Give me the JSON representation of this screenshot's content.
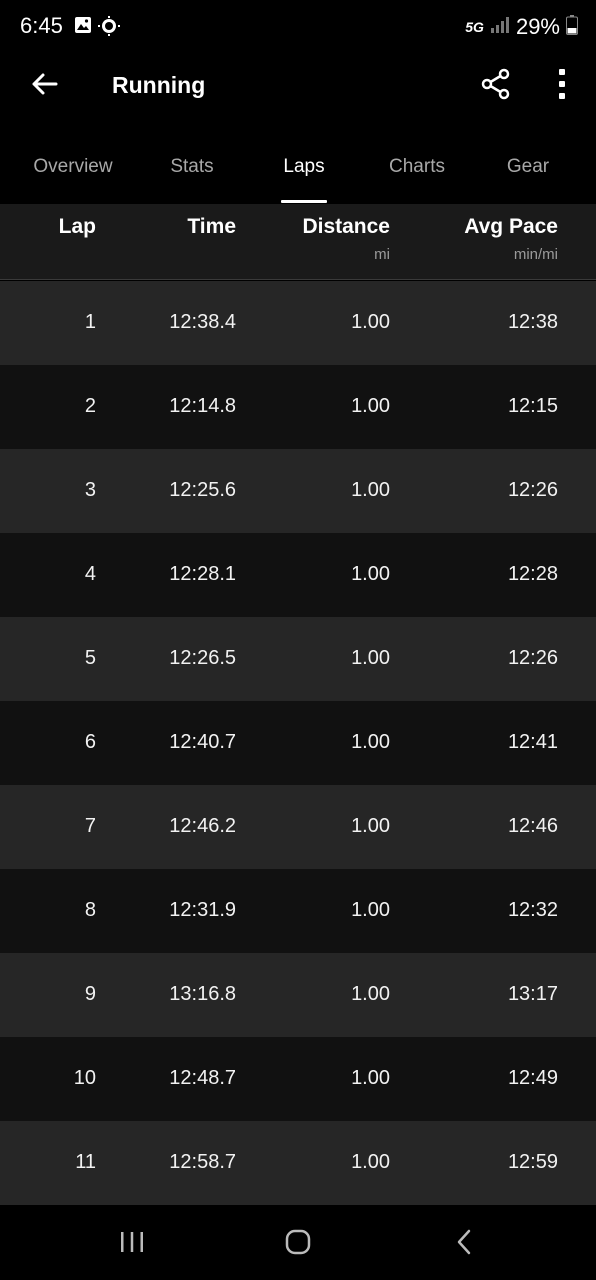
{
  "status_bar": {
    "time": "6:45",
    "network": "5G",
    "battery": "29%"
  },
  "app_bar": {
    "title": "Running"
  },
  "tabs": [
    {
      "label": "Overview",
      "active": false
    },
    {
      "label": "Stats",
      "active": false
    },
    {
      "label": "Laps",
      "active": true
    },
    {
      "label": "Charts",
      "active": false
    },
    {
      "label": "Gear",
      "active": false
    }
  ],
  "table": {
    "columns": [
      {
        "label": "Lap",
        "unit": ""
      },
      {
        "label": "Time",
        "unit": ""
      },
      {
        "label": "Distance",
        "unit": "mi"
      },
      {
        "label": "Avg Pace",
        "unit": "min/mi"
      }
    ],
    "rows": [
      {
        "lap": "1",
        "time": "12:38.4",
        "distance": "1.00",
        "pace": "12:38"
      },
      {
        "lap": "2",
        "time": "12:14.8",
        "distance": "1.00",
        "pace": "12:15"
      },
      {
        "lap": "3",
        "time": "12:25.6",
        "distance": "1.00",
        "pace": "12:26"
      },
      {
        "lap": "4",
        "time": "12:28.1",
        "distance": "1.00",
        "pace": "12:28"
      },
      {
        "lap": "5",
        "time": "12:26.5",
        "distance": "1.00",
        "pace": "12:26"
      },
      {
        "lap": "6",
        "time": "12:40.7",
        "distance": "1.00",
        "pace": "12:41"
      },
      {
        "lap": "7",
        "time": "12:46.2",
        "distance": "1.00",
        "pace": "12:46"
      },
      {
        "lap": "8",
        "time": "12:31.9",
        "distance": "1.00",
        "pace": "12:32"
      },
      {
        "lap": "9",
        "time": "13:16.8",
        "distance": "1.00",
        "pace": "13:17"
      },
      {
        "lap": "10",
        "time": "12:48.7",
        "distance": "1.00",
        "pace": "12:49"
      },
      {
        "lap": "11",
        "time": "12:58.7",
        "distance": "1.00",
        "pace": "12:59"
      }
    ]
  },
  "icons": {
    "back": "arrow-left-icon",
    "share": "share-icon",
    "more": "more-vertical-icon",
    "recents": "recent-apps-icon",
    "home": "home-icon",
    "nav_back": "nav-back-icon"
  },
  "colors": {
    "background": "#000000",
    "row_odd": "#262626",
    "row_even": "#111111",
    "header_bg": "#1a1a1a",
    "inactive_tab": "#a8a8a8"
  }
}
